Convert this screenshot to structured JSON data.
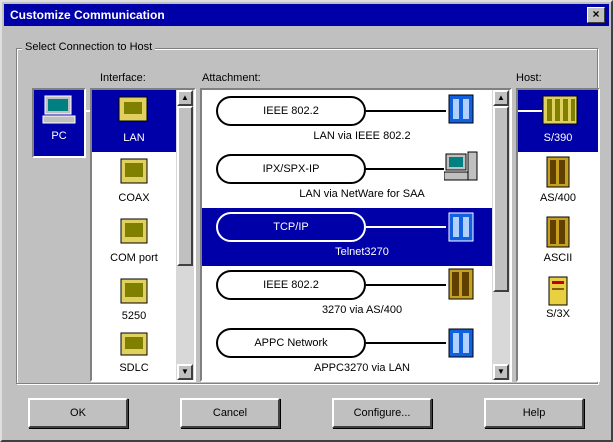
{
  "window": {
    "title": "Customize Communication",
    "close_label": "×"
  },
  "group": {
    "label": "Select Connection to Host"
  },
  "columns": {
    "interface": "Interface:",
    "attachment": "Attachment:",
    "host": "Host:"
  },
  "pc": {
    "label": "PC"
  },
  "interfaces": [
    "LAN",
    "COAX",
    "COM port",
    "5250",
    "SDLC"
  ],
  "attachments": [
    {
      "protocol": "IEEE 802.2",
      "label": "LAN via IEEE 802.2"
    },
    {
      "protocol": "IPX/SPX-IP",
      "label": "LAN via NetWare for SAA"
    },
    {
      "protocol": "TCP/IP",
      "label": "Telnet3270"
    },
    {
      "protocol": "IEEE 802.2",
      "label": "3270 via AS/400"
    },
    {
      "protocol": "APPC Network",
      "label": "APPC3270 via LAN"
    }
  ],
  "hosts": [
    "S/390",
    "AS/400",
    "ASCII",
    "S/3X"
  ],
  "buttons": {
    "ok": "OK",
    "cancel": "Cancel",
    "configure": "Configure...",
    "help": "Help"
  },
  "colors": {
    "selection": "#0000a8",
    "face": "#c0c0c0"
  }
}
